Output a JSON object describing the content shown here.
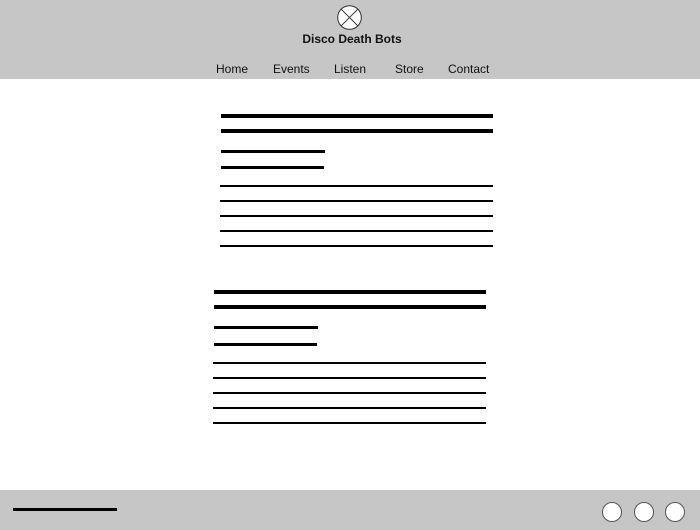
{
  "header": {
    "site_title": "Disco Death Bots",
    "logo_icon": "image-placeholder-icon",
    "background_color": "#c6c6c6"
  },
  "nav": {
    "items": [
      {
        "label": "Home"
      },
      {
        "label": "Events"
      },
      {
        "label": "Listen"
      },
      {
        "label": "Store"
      },
      {
        "label": "Contact"
      }
    ]
  },
  "footer": {
    "background_color": "#c6c6c6",
    "social_icons": [
      "social-icon-1",
      "social-icon-2",
      "social-icon-3"
    ]
  }
}
